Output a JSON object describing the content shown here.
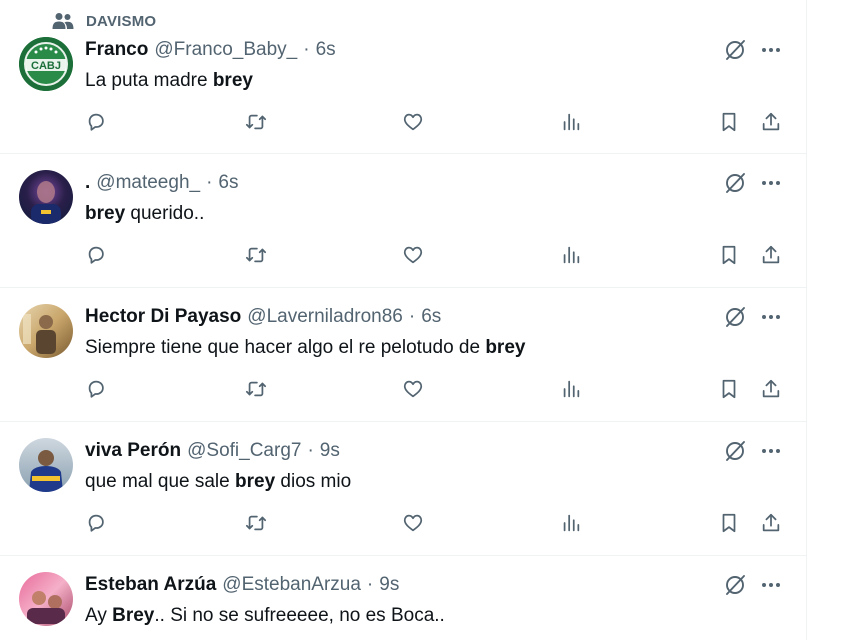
{
  "community": {
    "name": "DAVISMO",
    "icon": "people-icon"
  },
  "colors": {
    "text": "#0f1419",
    "secondary": "#536471",
    "border": "#eff3f4"
  },
  "tweets": [
    {
      "name": "Franco",
      "handle": "@Franco_Baby_",
      "time": "6s",
      "text_before": "La puta madre ",
      "highlight": "brey",
      "text_after": "",
      "avatar": "cabj-logo"
    },
    {
      "name": ".",
      "handle": "@mateegh_",
      "time": "6s",
      "text_before": "",
      "highlight": "brey",
      "text_after": " querido..",
      "avatar": "user-photo"
    },
    {
      "name": "Hector Di Payaso",
      "handle": "@Laverniladron86",
      "time": "6s",
      "text_before": "Siempre tiene que hacer algo el re pelotudo de ",
      "highlight": "brey",
      "text_after": "",
      "avatar": "user-photo"
    },
    {
      "name": "viva Perón",
      "handle": "@Sofi_Carg7",
      "time": "9s",
      "text_before": "que mal que sale ",
      "highlight": "brey",
      "text_after": " dios mio",
      "avatar": "user-photo"
    },
    {
      "name": "Esteban Arzúa",
      "handle": "@EstebanArzua",
      "time": "9s",
      "text_before": "Ay ",
      "highlight": "Brey",
      "text_after": ".. Si no se sufreeeee, no es Boca..",
      "avatar": "user-photo"
    }
  ],
  "avatar_badge": {
    "text": "CABJ"
  },
  "dot_separator": "·",
  "action_icons": [
    "reply-icon",
    "retweet-icon",
    "like-icon",
    "views-icon",
    "bookmark-icon",
    "share-icon"
  ],
  "top_icons": [
    "grok-icon",
    "more-icon"
  ]
}
